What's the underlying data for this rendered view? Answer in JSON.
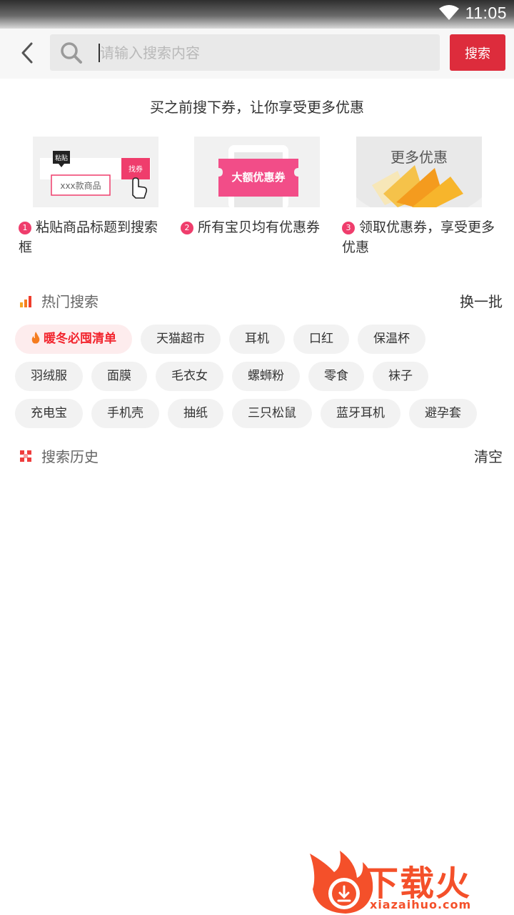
{
  "status_bar": {
    "time": "11:05",
    "wifi_icon": "wifi-icon"
  },
  "header": {
    "back_icon": "chevron-left-icon",
    "search_icon": "search-icon",
    "search_placeholder": "请输入搜索内容",
    "search_value": "",
    "search_button": "搜索"
  },
  "promo": {
    "title": "买之前搜下券，让你享受更多优惠",
    "steps": [
      {
        "num": "1",
        "text": "粘贴商品标题到搜索框",
        "img_label_paste": "粘贴",
        "img_label_find": "找券",
        "img_label_product": "xxx款商品"
      },
      {
        "num": "2",
        "text": "所有宝贝均有优惠券",
        "img_label_coupon": "大额优惠券"
      },
      {
        "num": "3",
        "text": "领取优惠券，享受更多优惠",
        "img_label_more": "更多优惠"
      }
    ]
  },
  "hot_search": {
    "title": "热门搜索",
    "action": "换一批",
    "rows": [
      [
        "暖冬必囤清单",
        "天猫超市",
        "耳机",
        "口红",
        "保温杯"
      ],
      [
        "羽绒服",
        "面膜",
        "毛衣女",
        "螺蛳粉",
        "零食",
        "袜子"
      ],
      [
        "充电宝",
        "手机壳",
        "抽纸",
        "三只松鼠",
        "蓝牙耳机",
        "避孕套"
      ]
    ]
  },
  "history": {
    "title": "搜索历史",
    "action": "清空"
  },
  "watermark": {
    "text": "下载火",
    "url": "xiazaihuo.com"
  },
  "colors": {
    "accent": "#dd2c3c",
    "pink": "#ef3d6c",
    "hot_tag_text": "#f2252e",
    "watermark": "#f4502a"
  }
}
